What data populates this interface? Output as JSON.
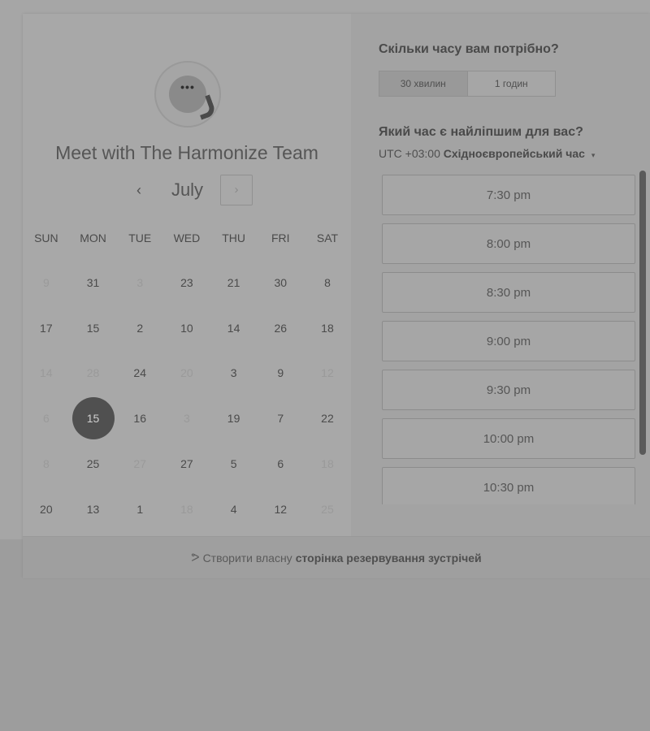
{
  "header": {
    "title": "Meet with The Harmonize Team",
    "avatar_icon": "chat-bubble-icon",
    "avatar_dots": "•••"
  },
  "calendar": {
    "month": "July",
    "prev_icon": "‹",
    "next_icon": "›",
    "weekdays": [
      "SUN",
      "MON",
      "TUE",
      "WED",
      "THU",
      "FRI",
      "SAT"
    ],
    "rows": [
      [
        {
          "d": "9",
          "m": true
        },
        {
          "d": "31"
        },
        {
          "d": "3",
          "m": true
        },
        {
          "d": "23"
        },
        {
          "d": "21"
        },
        {
          "d": "30"
        },
        {
          "d": "8"
        }
      ],
      [
        {
          "d": "17"
        },
        {
          "d": "15"
        },
        {
          "d": "2"
        },
        {
          "d": "10"
        },
        {
          "d": "14"
        },
        {
          "d": "26"
        },
        {
          "d": "18"
        }
      ],
      [
        {
          "d": "14",
          "m": true
        },
        {
          "d": "28",
          "m": true
        },
        {
          "d": "24"
        },
        {
          "d": "20",
          "m": true
        },
        {
          "d": "3"
        },
        {
          "d": "9"
        },
        {
          "d": "12",
          "m": true
        }
      ],
      [
        {
          "d": "6",
          "m": true
        },
        {
          "d": "15",
          "s": true
        },
        {
          "d": "16"
        },
        {
          "d": "3",
          "m": true
        },
        {
          "d": "19"
        },
        {
          "d": "7"
        },
        {
          "d": "22"
        }
      ],
      [
        {
          "d": "8",
          "m": true
        },
        {
          "d": "25"
        },
        {
          "d": "27",
          "m": true
        },
        {
          "d": "27"
        },
        {
          "d": "5"
        },
        {
          "d": "6"
        },
        {
          "d": "18",
          "m": true
        }
      ],
      [
        {
          "d": "20"
        },
        {
          "d": "13"
        },
        {
          "d": "1"
        },
        {
          "d": "18",
          "m": true
        },
        {
          "d": "4"
        },
        {
          "d": "12"
        },
        {
          "d": "25",
          "m": true
        }
      ]
    ]
  },
  "booking": {
    "duration_question": "Скільки часу вам потрібно?",
    "durations": [
      "30 хвилин",
      "1 годин"
    ],
    "time_question": "Який час є найліпшим для вас?",
    "timezone_offset": "UTC +03:00",
    "timezone_name": "Східноєвропейський час",
    "timezone_caret": "▾",
    "slots": [
      "7:30 pm",
      "8:00 pm",
      "8:30 pm",
      "9:00 pm",
      "9:30 pm",
      "10:00 pm",
      "10:30 pm"
    ]
  },
  "footer": {
    "icon": "hubspot-sprocket-icon",
    "icon_glyph": "ᕗ",
    "text": "Створити власну",
    "link": "сторінка резервування зустрічей"
  }
}
